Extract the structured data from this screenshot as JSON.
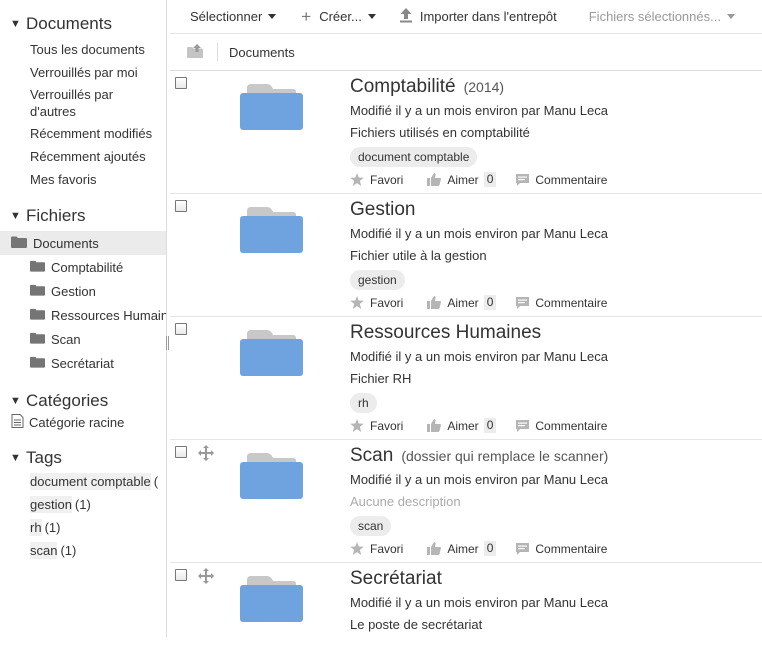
{
  "sidebar": {
    "documents_header": "Documents",
    "documents_links": [
      "Tous les documents",
      "Verrouillés par moi",
      "Verrouillés par d'autres",
      "Récemment modifiés",
      "Récemment ajoutés",
      "Mes favoris"
    ],
    "files_header": "Fichiers",
    "files_root": "Documents",
    "files_children": [
      "Comptabilité",
      "Gestion",
      "Ressources Humaines",
      "Scan",
      "Secrétariat"
    ],
    "categories_header": "Catégories",
    "category_root": "Catégorie racine",
    "tags_header": "Tags",
    "tags": [
      {
        "name": "document comptable",
        "count": "("
      },
      {
        "name": "gestion",
        "count": "(1)"
      },
      {
        "name": "rh",
        "count": "(1)"
      },
      {
        "name": "scan",
        "count": "(1)"
      }
    ]
  },
  "toolbar": {
    "select_label": "Sélectionner",
    "create_label": "Créer...",
    "upload_label": "Importer dans l'entrepôt",
    "selected_files_label": "Fichiers sélectionnés..."
  },
  "path": {
    "current": "Documents"
  },
  "actions": {
    "favorite": "Favori",
    "like": "Aimer",
    "comment": "Commentaire"
  },
  "documents": [
    {
      "title": "Comptabilité",
      "extra": "(2014)",
      "modified": "Modifié il y a un mois environ par Manu Leca",
      "description": "Fichiers utilisés en comptabilité",
      "tag": "document comptable",
      "likes": "0"
    },
    {
      "title": "Gestion",
      "extra": "",
      "modified": "Modifié il y a un mois environ par Manu Leca",
      "description": "Fichier utile à la gestion",
      "tag": "gestion",
      "likes": "0"
    },
    {
      "title": "Ressources Humaines",
      "extra": "",
      "modified": "Modifié il y a un mois environ par Manu Leca",
      "description": "Fichier RH",
      "tag": "rh",
      "likes": "0"
    },
    {
      "title": "Scan",
      "extra": "(dossier qui remplace le scanner)",
      "modified": "Modifié il y a un mois environ par Manu Leca",
      "description": "Aucune description",
      "tag": "scan",
      "likes": "0"
    },
    {
      "title": "Secrétariat",
      "extra": "",
      "modified": "Modifié il y a un mois environ par Manu Leca",
      "description": "Le poste de secrétariat",
      "tag": "",
      "likes": ""
    }
  ],
  "colors": {
    "folder_blue": "#6fa3e0",
    "folder_tab": "#c8c8c8",
    "selected_bg": "#ebebeb",
    "tag_bg": "#ececec"
  }
}
